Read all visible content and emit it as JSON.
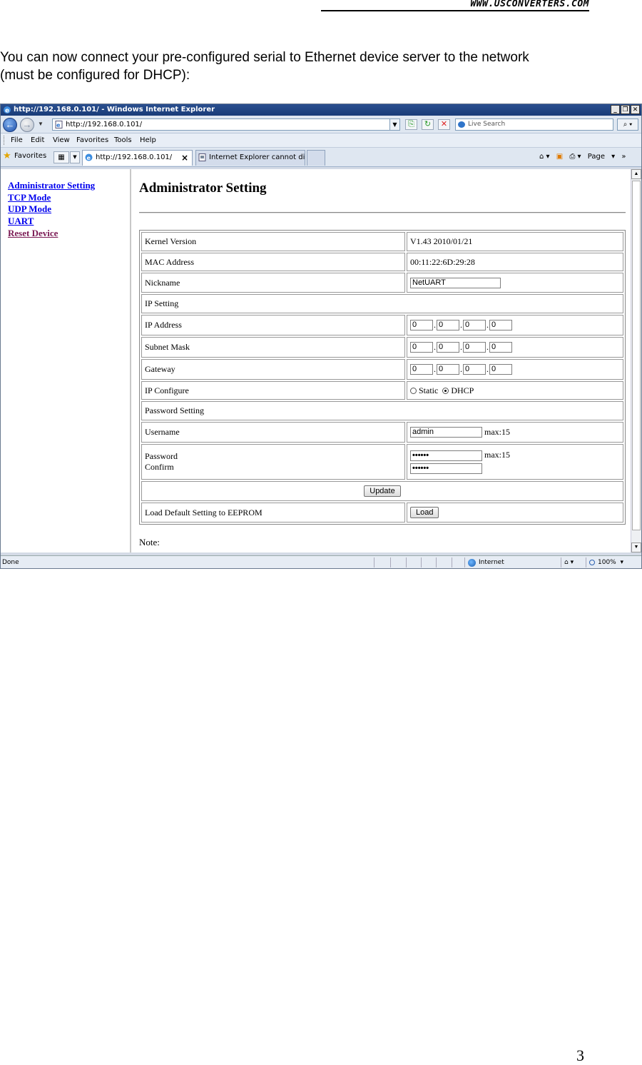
{
  "site_header": "WWW.USCONVERTERS.COM",
  "intro": {
    "line1": "You can now connect your pre-configured serial to Ethernet device server to the network",
    "line2": "(must be configured for DHCP):"
  },
  "page_number": "3",
  "browser": {
    "window_title": "http://192.168.0.101/ - Windows Internet Explorer",
    "url": "http://192.168.0.101/",
    "search_placeholder": "Live Search",
    "menu": [
      "File",
      "Edit",
      "View",
      "Favorites",
      "Tools",
      "Help"
    ],
    "favorites_label": "Favorites",
    "tabs": [
      {
        "label": "http://192.168.0.101/"
      },
      {
        "label": "Internet Explorer cannot dis..."
      }
    ],
    "page_menu": "Page",
    "status": {
      "text": "Done",
      "zone": "Internet",
      "zoom": "100%"
    }
  },
  "sidebar": {
    "links": [
      "Administrator Setting",
      "TCP Mode",
      "UDP Mode",
      "UART",
      "Reset Device"
    ]
  },
  "admin": {
    "title": "Administrator Setting",
    "kernel_label": "Kernel Version",
    "kernel_value": "V1.43 2010/01/21",
    "mac_label": "MAC Address",
    "mac_value": "00:11:22:6D:29:28",
    "nickname_label": "Nickname",
    "nickname_value": "NetUART",
    "ip_section": "IP Setting",
    "ip_label": "IP Address",
    "ip_value": [
      "0",
      "0",
      "0",
      "0"
    ],
    "subnet_label": "Subnet Mask",
    "subnet_value": [
      "0",
      "0",
      "0",
      "0"
    ],
    "gateway_label": "Gateway",
    "gateway_value": [
      "0",
      "0",
      "0",
      "0"
    ],
    "ipconf_label": "IP Configure",
    "ipconf_options": [
      "Static",
      "DHCP"
    ],
    "ipconf_selected": "DHCP",
    "pw_section": "Password Setting",
    "user_label": "Username",
    "user_value": "admin",
    "max_hint": "max:15",
    "pw_label": "Password",
    "confirm_label": "Confirm",
    "pw_mask": "••••••",
    "update_button": "Update",
    "load_label": "Load Default Setting to EEPROM",
    "load_button": "Load",
    "note": "Note:"
  }
}
